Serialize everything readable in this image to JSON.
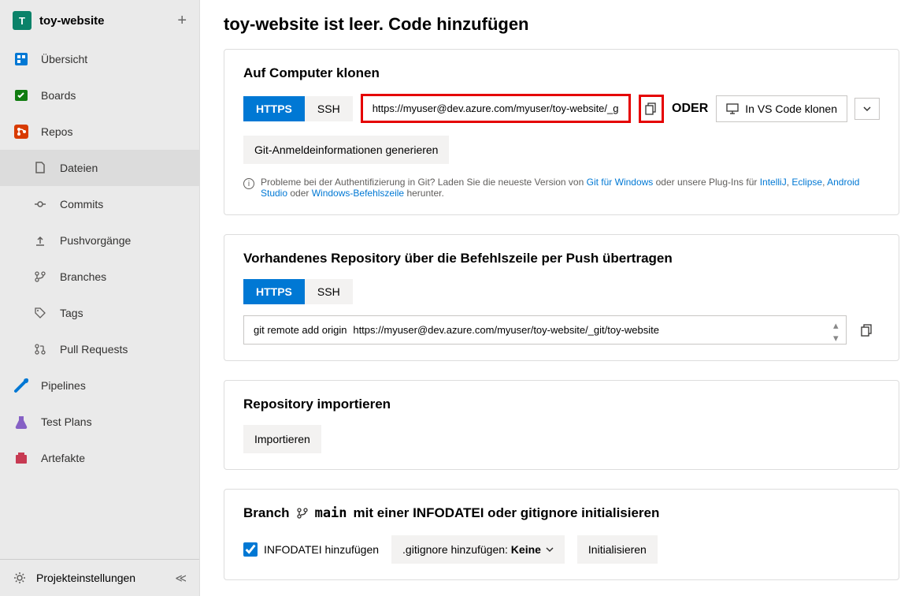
{
  "sidebar": {
    "project_badge": "T",
    "project_name": "toy-website",
    "items": [
      {
        "label": "Übersicht"
      },
      {
        "label": "Boards"
      },
      {
        "label": "Repos"
      },
      {
        "label": "Dateien"
      },
      {
        "label": "Commits"
      },
      {
        "label": "Pushvorgänge"
      },
      {
        "label": "Branches"
      },
      {
        "label": "Tags"
      },
      {
        "label": "Pull Requests"
      },
      {
        "label": "Pipelines"
      },
      {
        "label": "Test Plans"
      },
      {
        "label": "Artefakte"
      }
    ],
    "footer": "Projekteinstellungen"
  },
  "main": {
    "title": "toy-website ist leer. Code hinzufügen"
  },
  "clone": {
    "heading": "Auf Computer klonen",
    "tab_https": "HTTPS",
    "tab_ssh": "SSH",
    "url": "https://myuser@dev.azure.com/myuser/toy-website/_git/toy-website",
    "oder": "ODER",
    "vscode": "In VS Code klonen",
    "gen_creds": "Git-Anmeldeinformationen generieren",
    "info_pre": "Probleme bei der Authentifizierung in Git? Laden Sie die neueste Version von ",
    "info_link1": "Git für Windows",
    "info_mid": " oder unsere Plug-Ins für ",
    "info_link2": "IntelliJ",
    "info_link3": "Eclipse",
    "info_link4": "Android Studio",
    "info_mid2": " oder ",
    "info_link5": "Windows-Befehlszeile",
    "info_end": " herunter."
  },
  "push": {
    "heading": "Vorhandenes Repository über die Befehlszeile per Push übertragen",
    "tab_https": "HTTPS",
    "tab_ssh": "SSH",
    "cmd_prefix": "git remote add origin",
    "cmd_url": "https://myuser@dev.azure.com/myuser/toy-website/_git/toy-website"
  },
  "import": {
    "heading": "Repository importieren",
    "btn": "Importieren"
  },
  "init": {
    "heading_pre": "Branch",
    "branch": "main",
    "heading_post": "mit einer INFODATEI oder gitignore initialisieren",
    "readme": "INFODATEI hinzufügen",
    "gitignore_pre": ".gitignore hinzufügen: ",
    "gitignore_val": "Keine",
    "btn": "Initialisieren"
  }
}
